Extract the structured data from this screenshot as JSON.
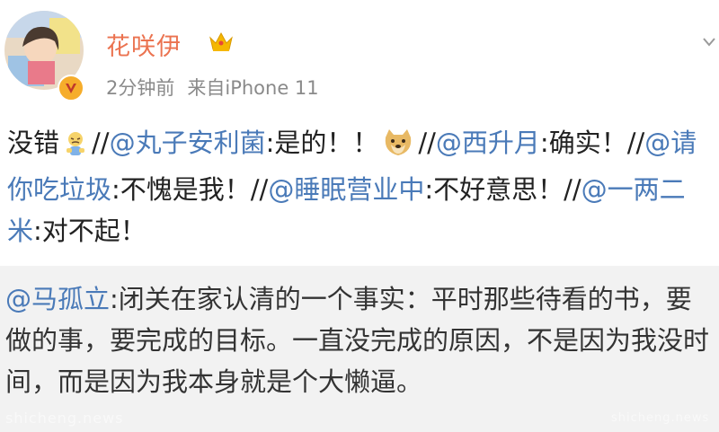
{
  "user": {
    "name": "花咲伊",
    "time": "2分钟前",
    "source": "来自iPhone 11",
    "crown_color": "#f5b700",
    "verified_color": "#f6ad2b"
  },
  "post": {
    "p1": "没错",
    "p2": "//",
    "m1": "@丸子安利菌",
    "p3": ":是的！！",
    "p4": "//",
    "m2": "@西升月",
    "p5": ":确实！//",
    "m3": "@请你吃垃圾",
    "p6": ":不愧是我！//",
    "m4": "@睡眠营业中",
    "p7": ":不好意思！//",
    "m5": "@一两二米",
    "p8": ":对不起！"
  },
  "repost": {
    "mention": "@马孤立",
    "text": ":闭关在家认清的一个事实：平时那些待看的书，要做的事，要完成的目标。一直没完成的原因，不是因为我没时间，而是因为我本身就是个大懒逼。"
  },
  "watermark": {
    "left": "shicheng.news",
    "right": "shicheng.news"
  },
  "icons": {
    "crown": "crown-icon",
    "verified": "verified-v-icon",
    "menu": "chevron-down-icon",
    "emoji1": "tired-face-emoji-icon",
    "emoji2": "doge-emoji-icon"
  },
  "colors": {
    "username": "#eb7350",
    "mention": "#4a7ab8",
    "meta": "#8a8a8a",
    "repost_bg": "#f2f2f2"
  }
}
